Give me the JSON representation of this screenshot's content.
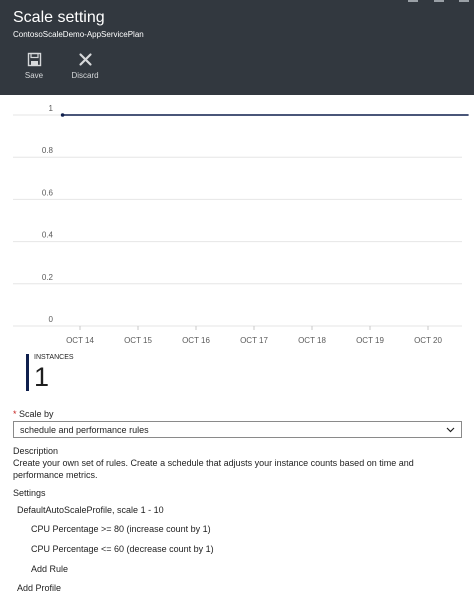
{
  "header": {
    "title": "Scale setting",
    "subtitle": "ContosoScaleDemo-AppServicePlan",
    "background": "#32383f"
  },
  "toolbar": {
    "save_label": "Save",
    "discard_label": "Discard"
  },
  "chart_data": {
    "type": "line",
    "y_ticks": [
      "1",
      "0.8",
      "0.6",
      "0.4",
      "0.2",
      "0"
    ],
    "ylim": [
      0,
      1
    ],
    "categories": [
      "OCT 14",
      "OCT 15",
      "OCT 16",
      "OCT 17",
      "OCT 18",
      "OCT 19",
      "OCT 20"
    ],
    "x_range": [
      13.7,
      20.7
    ],
    "series": [
      {
        "x": [
          13.7,
          20.7
        ],
        "values": [
          1,
          1
        ],
        "color": "#0f1f4d"
      }
    ],
    "grid": true
  },
  "instances": {
    "label": "INSTANCES",
    "value": "1"
  },
  "scale_by": {
    "required_mark": "*",
    "label": "Scale by",
    "selected": "schedule and performance rules"
  },
  "description": {
    "heading": "Description",
    "text": "Create your own set of rules. Create a schedule that adjusts your instance counts based on time and performance metrics."
  },
  "settings": {
    "heading": "Settings",
    "profile": "DefaultAutoScaleProfile, scale 1 - 10",
    "rules": [
      "CPU Percentage >= 80 (increase count by 1)",
      "CPU Percentage <= 60 (decrease count by 1)"
    ],
    "add_rule": "Add Rule",
    "add_profile": "Add Profile"
  }
}
